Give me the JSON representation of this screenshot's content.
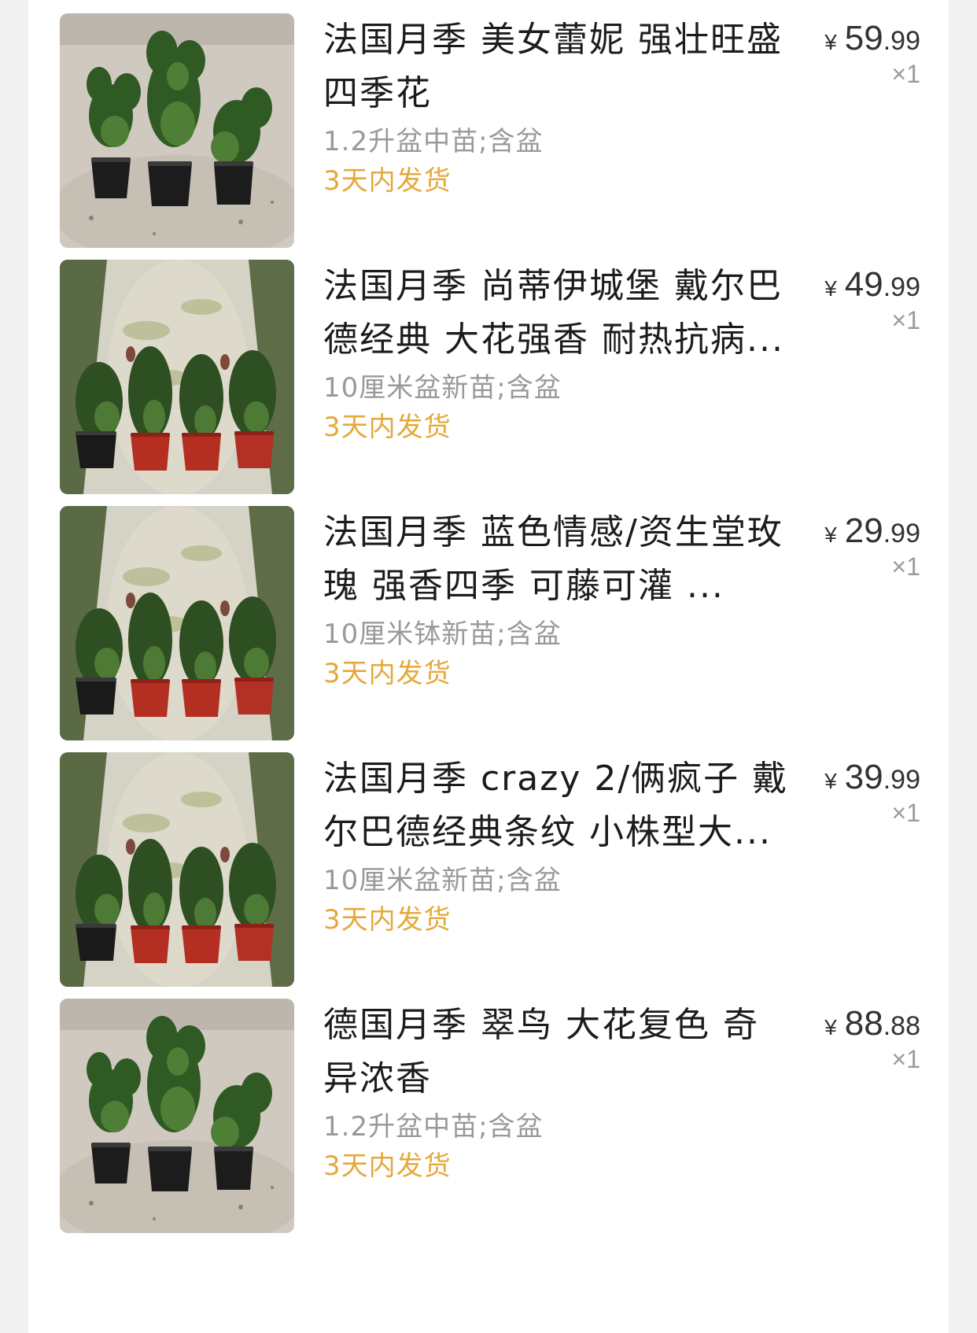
{
  "order": {
    "items": [
      {
        "title": "法国月季  美女蕾妮  强壮旺盛  四季花",
        "spec": "1.2升盆中苗;含盆",
        "shipping": "3天内发货",
        "currency": "¥",
        "price_int": "59",
        "price_dec": ".99",
        "quantity": "×1",
        "image": "three-black-pots-rose-seedlings"
      },
      {
        "title": "法国月季 尚蒂伊城堡 戴尔巴德经典 大花强香  耐热抗病...",
        "spec": "10厘米盆新苗;含盆",
        "shipping": "3天内发货",
        "currency": "¥",
        "price_int": "49",
        "price_dec": ".99",
        "quantity": "×1",
        "image": "four-pots-rose-seedlings"
      },
      {
        "title": "法国月季 蓝色情感/资生堂玫瑰 强香四季 可藤可灌 ...",
        "spec": "10厘米钵新苗;含盆",
        "shipping": "3天内发货",
        "currency": "¥",
        "price_int": "29",
        "price_dec": ".99",
        "quantity": "×1",
        "image": "four-pots-rose-seedlings"
      },
      {
        "title": "法国月季 crazy 2/俩疯子  戴尔巴德经典条纹 小株型大...",
        "spec": "10厘米盆新苗;含盆",
        "shipping": "3天内发货",
        "currency": "¥",
        "price_int": "39",
        "price_dec": ".99",
        "quantity": "×1",
        "image": "four-pots-rose-seedlings"
      },
      {
        "title": "德国月季 翠鸟 大花复色 奇异浓香",
        "spec": "1.2升盆中苗;含盆",
        "shipping": "3天内发货",
        "currency": "¥",
        "price_int": "88",
        "price_dec": ".88",
        "quantity": "×1",
        "image": "three-black-pots-rose-seedlings"
      }
    ]
  },
  "colors": {
    "shipping": "#e5a93b",
    "spec": "#999999",
    "title": "#1c1c1c",
    "background": "#f1f1f1"
  }
}
